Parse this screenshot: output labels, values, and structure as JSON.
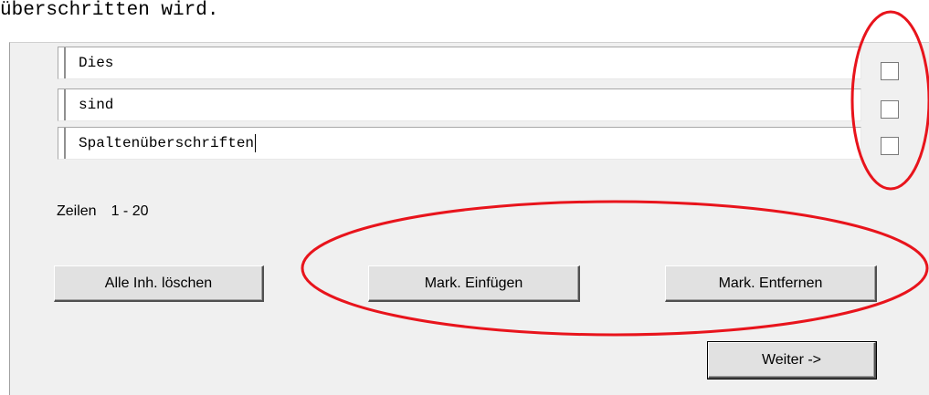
{
  "caption": "überschritten wird.",
  "headers": [
    {
      "value": "Dies",
      "checked": false
    },
    {
      "value": "sind",
      "checked": false
    },
    {
      "value": "Spaltenüberschriften",
      "checked": false,
      "focused": true
    }
  ],
  "rows_label": "Zeilen",
  "rows_range": "1 - 20",
  "buttons": {
    "clear_all": "Alle Inh. löschen",
    "insert_marks": "Mark. Einfügen",
    "remove_marks": "Mark. Entfernen",
    "next": "Weiter ->"
  },
  "annotation_color": "#e8141c"
}
